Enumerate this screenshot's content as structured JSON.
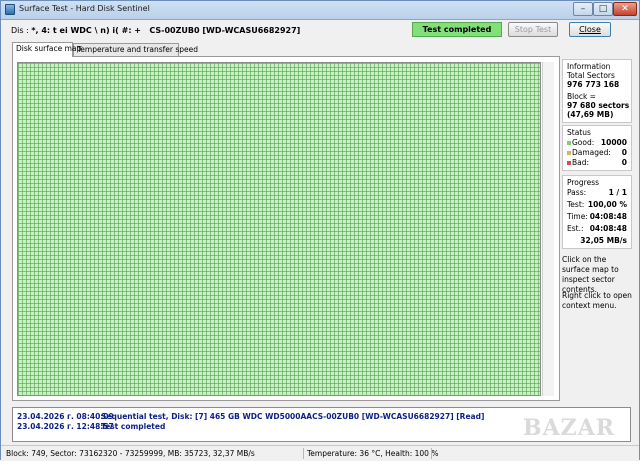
{
  "window": {
    "title": "Surface Test - Hard Disk Sentinel",
    "controls": {
      "minimize": "–",
      "maximize": "□",
      "close": "✕"
    }
  },
  "toolbar": {
    "disk_prefix": "Dis :",
    "disk_text": "*, 4: t  ei  WDC \\ n) i( #: +   CS-00ZUB0 [WD-WCASU6682927]",
    "status": "Test completed",
    "stop_label": "Stop Test",
    "close_label": "Close",
    "status_color": "#82e07a"
  },
  "tabs": [
    {
      "label": "Disk surface map",
      "active": true
    },
    {
      "label": "Temperature and transfer speed",
      "active": false
    }
  ],
  "surface_map": {
    "block_color": "#c9f0c3",
    "state": "all blocks good"
  },
  "information": {
    "title": "Information",
    "total_label": "Total Sectors",
    "total_value": "976 773 168",
    "block_label": "Block =",
    "block_sectors": "97 680 sectors",
    "block_size": "(47,69 MB)"
  },
  "status_panel": {
    "title": "Status",
    "good_label": "Good:",
    "good_value": "10000",
    "damaged_label": "Damaged:",
    "damaged_value": "0",
    "bad_label": "Bad:",
    "bad_value": "0",
    "colors": {
      "good": "#7ecf76",
      "damaged": "#e0b060",
      "bad": "#d05050"
    }
  },
  "progress": {
    "title": "Progress",
    "pass_label": "Pass:",
    "pass_value": "1 / 1",
    "test_label": "Test:",
    "test_value": "100,00 %",
    "time_label": "Time:",
    "time_value": "04:08:48",
    "est_label": "Est.:",
    "est_value": "04:08:48",
    "speed": "32,05 MB/s"
  },
  "help": {
    "line1": "Click on the surface map to inspect sector contents.",
    "line2": "Right click to open context menu."
  },
  "log": [
    {
      "date": "23.04.2026 г.  08:40:09",
      "text": "Sequential test, Disk: [7] 465 GB  WDC WD5000AACS-00ZUB0 [WD-WCASU6682927] [Read]"
    },
    {
      "date": "23.04.2026 г.  12:48:57",
      "text": "Test completed"
    }
  ],
  "statusbar": {
    "left": "Block: 749, Sector: 73162320 - 73259999, MB: 35723, 32,37 MB/s",
    "temp": "Temperature: 36  °C,  Health: 100 %"
  },
  "watermark": "BAZAR"
}
